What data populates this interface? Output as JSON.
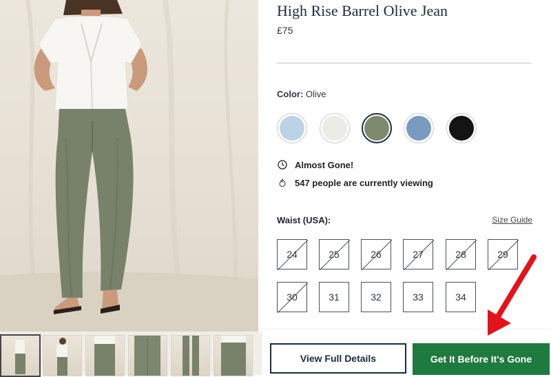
{
  "product": {
    "title": "High Rise Barrel Olive Jean",
    "price": "£75"
  },
  "color": {
    "label": "Color:",
    "selected": "Olive",
    "swatches": [
      {
        "name": "light-wash",
        "hex": "#bcd3e6"
      },
      {
        "name": "ecru",
        "hex": "#ecebe6"
      },
      {
        "name": "olive",
        "hex": "#7d8a6e"
      },
      {
        "name": "mid-wash",
        "hex": "#7a9bc0"
      },
      {
        "name": "black",
        "hex": "#141414"
      }
    ]
  },
  "stock": {
    "almost_gone": "Almost Gone!",
    "viewing": "547 people are currently viewing",
    "clock_icon": "clock-icon",
    "fire_icon": "flame-icon"
  },
  "waist": {
    "label": "Waist (USA):",
    "size_guide": "Size Guide",
    "sizes": [
      {
        "value": "24",
        "available": false
      },
      {
        "value": "25",
        "available": false
      },
      {
        "value": "26",
        "available": false
      },
      {
        "value": "27",
        "available": false
      },
      {
        "value": "28",
        "available": false
      },
      {
        "value": "29",
        "available": false
      },
      {
        "value": "30",
        "available": false
      },
      {
        "value": "31",
        "available": true
      },
      {
        "value": "32",
        "available": true
      },
      {
        "value": "33",
        "available": true
      },
      {
        "value": "34",
        "available": true
      }
    ]
  },
  "actions": {
    "details": "View Full Details",
    "buy": "Get It Before It's Gone"
  },
  "colors": {
    "primary": "#1c2b3a",
    "buy_button": "#1f7a3f",
    "arrow": "#e3131b"
  }
}
